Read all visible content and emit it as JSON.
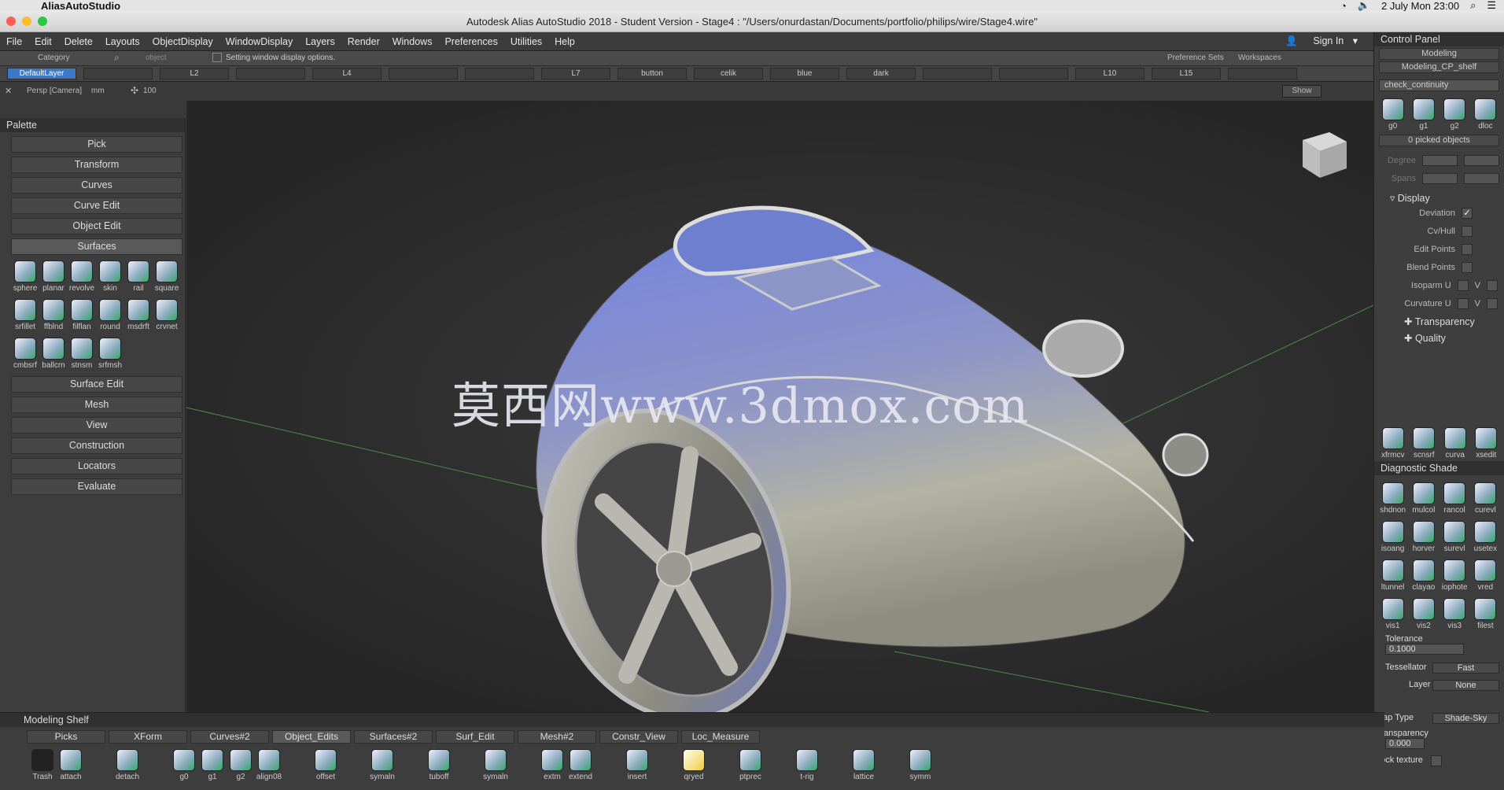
{
  "os": {
    "app_name": "AliasAutoStudio",
    "clock": "2 July Mon  23:00"
  },
  "window": {
    "title": "Autodesk Alias AutoStudio 2018 - Student Version   - Stage4 : \"/Users/onurdastan/Documents/portfolio/philips/wire/Stage4.wire\""
  },
  "menu": {
    "items": [
      "File",
      "Edit",
      "Delete",
      "Layouts",
      "ObjectDisplay",
      "WindowDisplay",
      "Layers",
      "Render",
      "Windows",
      "Preferences",
      "Utilities",
      "Help"
    ],
    "sign_in": "Sign In"
  },
  "layerbar": {
    "category": "Category",
    "object": "object",
    "status": "Setting window display options.",
    "preference_sets": "Preference Sets",
    "workspaces": "Workspaces",
    "layers": [
      "DefaultLayer",
      "",
      "L2",
      "",
      "L4",
      "",
      "",
      "L7",
      "button",
      "celik",
      "blue",
      "dark",
      "",
      "",
      "L10",
      "L15",
      ""
    ]
  },
  "viewport": {
    "camera_label": "Persp [Camera]",
    "unit": "mm",
    "grid": "100",
    "show_button": "Show",
    "watermark": "莫西网www.3dmox.com"
  },
  "palette": {
    "title": "Palette",
    "sections_top": [
      "Pick",
      "Transform",
      "Curves",
      "Curve Edit",
      "Object Edit",
      "Surfaces"
    ],
    "surface_tools": [
      "sphere",
      "planar",
      "revolve",
      "skin",
      "rail",
      "square",
      "srfillet",
      "ffblnd",
      "filflan",
      "round",
      "msdrft",
      "crvnet",
      "cmbsrf",
      "ballcrn",
      "stnsm",
      "srfmsh"
    ],
    "sections_bottom": [
      "Surface Edit",
      "Mesh",
      "View",
      "Construction",
      "Locators",
      "Evaluate"
    ]
  },
  "control_panel": {
    "title": "Control Panel",
    "mode": "Modeling",
    "shelf_name": "Modeling_CP_shelf",
    "check": "check_continuity",
    "check_tools": [
      "g0",
      "g1",
      "g2",
      "dloc"
    ],
    "picked": "0 picked objects",
    "degree_label": "Degree",
    "spans_label": "Spans",
    "display_header": "Display",
    "display_options": [
      {
        "label": "Deviation",
        "checked": "✓"
      },
      {
        "label": "Cv/Hull",
        "checked": ""
      },
      {
        "label": "Edit Points",
        "checked": ""
      },
      {
        "label": "Blend Points",
        "checked": ""
      },
      {
        "label": "Isoparm U",
        "checked": "",
        "extra": "V"
      },
      {
        "label": "Curvature U",
        "checked": "",
        "extra": "V"
      }
    ],
    "transparency": "Transparency",
    "quality": "Quality",
    "bottom_tools": [
      "xfrmcv",
      "scnsrf",
      "curva",
      "xsedit"
    ]
  },
  "diagnostic": {
    "title": "Diagnostic Shade",
    "tools": [
      "shdnon",
      "mulcol",
      "rancol",
      "curevl",
      "isoang",
      "horver",
      "surevl",
      "usetex",
      "ltunnel",
      "clayao",
      "iophote",
      "vred",
      "vis1",
      "vis2",
      "vis3",
      "filest"
    ],
    "tolerance_label": "Tolerance",
    "tolerance": "0.1000",
    "tessellator_label": "Tessellator",
    "tessellator": "Fast",
    "layer_label": "Layer",
    "layer": "None",
    "maptype_label": "Map Type",
    "maptype": "Shade-Sky",
    "transparency_label": "Transparency",
    "transparency": "0.000",
    "lock_label": "Lock texture"
  },
  "shelf": {
    "title": "Modeling Shelf",
    "tabs": [
      "Picks",
      "XForm",
      "Curves#2",
      "Object_Edits",
      "Surfaces#2",
      "Surf_Edit",
      "Mesh#2",
      "Constr_View",
      "Loc_Measure"
    ],
    "tools": [
      "Trash",
      "attach",
      "",
      "detach",
      "",
      "g0",
      "g1",
      "g2",
      "align08",
      "",
      "offset",
      "",
      "symaln",
      "",
      "tuboff",
      "",
      "symaln",
      "",
      "extm",
      "extend",
      "",
      "insert",
      "",
      "qryed",
      "",
      "ptprec",
      "",
      "t-rig",
      "",
      "lattice",
      "",
      "symm"
    ]
  },
  "colors": {
    "accent": "#3d78c6",
    "model_blue": "#6f7fd0",
    "model_grey": "#a8a898"
  }
}
